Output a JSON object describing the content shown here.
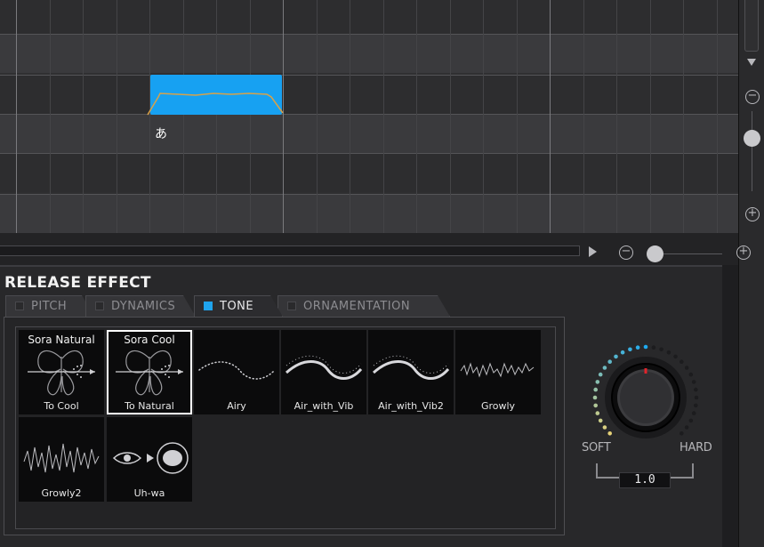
{
  "piano_roll": {
    "note_lyric": "あ"
  },
  "panel": {
    "title": "RELEASE EFFECT",
    "tabs": [
      {
        "label": "PITCH",
        "checked": false,
        "active": false
      },
      {
        "label": "DYNAMICS",
        "checked": false,
        "active": false
      },
      {
        "label": "TONE",
        "checked": true,
        "active": true
      },
      {
        "label": "ORNAMENTATION",
        "checked": false,
        "active": false
      }
    ],
    "presets": [
      {
        "top": "Sora Natural",
        "caption": "To Cool",
        "icon": "butterfly-icon",
        "selected": false
      },
      {
        "top": "Sora Cool",
        "caption": "To Natural",
        "icon": "butterfly-icon",
        "selected": true
      },
      {
        "top": "",
        "caption": "Airy",
        "icon": "airy-wave-icon",
        "selected": false
      },
      {
        "top": "",
        "caption": "Air_with_Vib",
        "icon": "vibrato-wave-icon",
        "selected": false
      },
      {
        "top": "",
        "caption": "Air_with_Vib2",
        "icon": "vibrato-wave-icon",
        "selected": false
      },
      {
        "top": "",
        "caption": "Growly",
        "icon": "growl-wave-icon",
        "selected": false
      },
      {
        "top": "",
        "caption": "Growly2",
        "icon": "growl-wave-icon",
        "selected": false
      },
      {
        "top": "",
        "caption": "Uh-wa",
        "icon": "mouth-shape-icon",
        "selected": false
      }
    ],
    "knob": {
      "min_label": "SOFT",
      "max_label": "HARD",
      "value": "1.0",
      "level": 0.5
    }
  },
  "colors": {
    "accent": "#17a1f2",
    "knob_indicator": "#e0242b"
  }
}
